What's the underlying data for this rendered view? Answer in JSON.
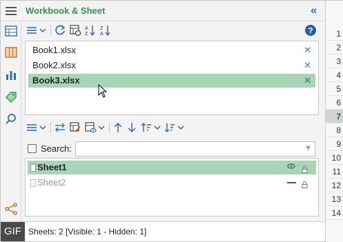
{
  "header": {
    "title": "Workbook & Sheet",
    "collapse_glyph": "«"
  },
  "workbooks": [
    {
      "label": "Book1.xlsx",
      "selected": false
    },
    {
      "label": "Book2.xlsx",
      "selected": false
    },
    {
      "label": "Book3.xlsx",
      "selected": true
    }
  ],
  "close_glyph": "✕",
  "search": {
    "label": "Search:",
    "value": "",
    "placeholder": ""
  },
  "sheets": [
    {
      "label": "Sheet1",
      "visible": true
    },
    {
      "label": "Sheet2",
      "visible": false
    }
  ],
  "status": {
    "text": "Sheets: 2  [Visible: 1 - Hidden: 1]"
  },
  "gif_badge": "GIF",
  "row_numbers": [
    "1",
    "2",
    "3",
    "4",
    "5",
    "6",
    "7",
    "8",
    "9",
    "10",
    "11",
    "12",
    "13",
    "14"
  ],
  "active_row": "7",
  "colors": {
    "accent_green": "#3c8d5c",
    "selection": "#a8d5b6",
    "blue_icon": "#2f6fb5",
    "help": "#1f5fa8"
  }
}
